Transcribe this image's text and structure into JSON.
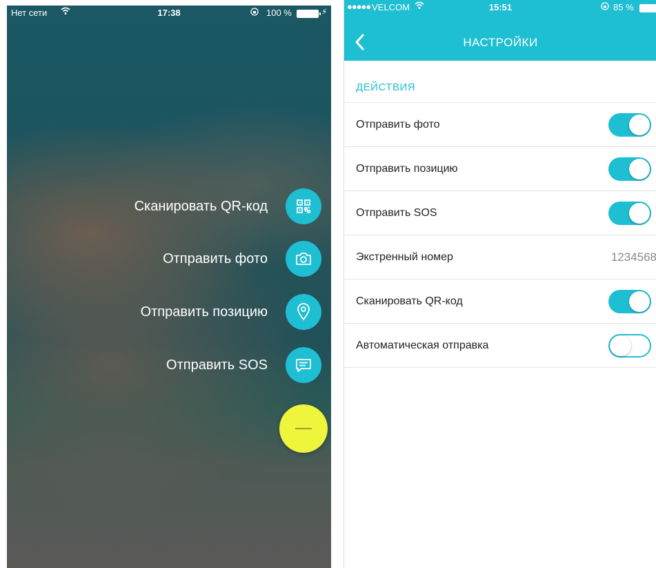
{
  "colors": {
    "accent": "#1ebed3",
    "fab_main": "#eef53a",
    "toggle_on": "#1ebed3"
  },
  "left_screen": {
    "status": {
      "carrier": "Нет сети",
      "time": "17:38",
      "battery": "100 %"
    },
    "actions": [
      {
        "label": "Сканировать QR-код",
        "icon": "qr-code-icon"
      },
      {
        "label": "Отправить фото",
        "icon": "camera-icon"
      },
      {
        "label": "Отправить позицию",
        "icon": "location-pin-icon"
      },
      {
        "label": "Отправить SOS",
        "icon": "message-icon"
      }
    ],
    "main_button_icon": "minus-icon"
  },
  "right_screen": {
    "status": {
      "dots": "●●●●●",
      "carrier": "VELCOM",
      "time": "15:51",
      "battery": "85 %"
    },
    "title": "НАСТРОЙКИ",
    "back_icon": "chevron-left-icon",
    "section_title": "ДЕЙСТВИЯ",
    "settings": [
      {
        "label": "Отправить фото",
        "type": "toggle",
        "on": true
      },
      {
        "label": "Отправить позицию",
        "type": "toggle",
        "on": true
      },
      {
        "label": "Отправить SOS",
        "type": "toggle",
        "on": true
      },
      {
        "label": "Экстренный номер",
        "type": "value",
        "value": "1234568"
      },
      {
        "label": "Сканировать QR-код",
        "type": "toggle",
        "on": true
      },
      {
        "label": "Автоматическая отправка",
        "type": "toggle",
        "on": false
      }
    ]
  }
}
